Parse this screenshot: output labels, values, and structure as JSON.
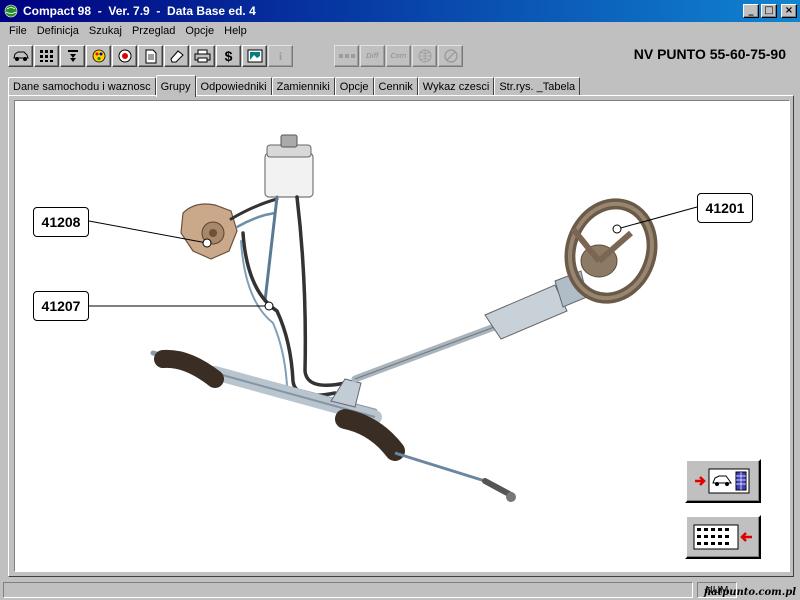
{
  "window": {
    "title": "Compact 98  -  Ver. 7.9  -  Data Base ed. 4",
    "minimize_glyph": "_",
    "maximize_glyph": "□",
    "close_glyph": "×"
  },
  "menu": {
    "items": [
      "File",
      "Definicja",
      "Szukaj",
      "Przeglad",
      "Opcje",
      "Help"
    ]
  },
  "toolbar": {
    "icons": [
      "car-icon",
      "grid-icon",
      "arrow-down-icon",
      "palette-icon",
      "target-icon",
      "document-icon",
      "eraser-icon",
      "printer-icon",
      "dollar-icon",
      "picture-icon",
      "info-icon"
    ],
    "dollar_glyph": "$",
    "info_glyph": "i",
    "disabled_labels": [
      "",
      "Diff",
      "Com"
    ]
  },
  "model": {
    "label": "NV PUNTO 55-60-75-90"
  },
  "tabs": [
    {
      "label": "Dane samochodu i waznosc",
      "active": false
    },
    {
      "label": "Grupy",
      "active": true
    },
    {
      "label": "Odpowiedniki",
      "active": false
    },
    {
      "label": "Zamienniki",
      "active": false
    },
    {
      "label": "Opcje",
      "active": false
    },
    {
      "label": "Cennik",
      "active": false
    },
    {
      "label": "Wykaz czesci",
      "active": false
    },
    {
      "label": "Str.rys. _Tabela",
      "active": false
    }
  ],
  "diagram": {
    "callouts": [
      "41208",
      "41207",
      "41201"
    ]
  },
  "status": {
    "num": "NUM"
  },
  "watermark": "fiatpunto.com.pl",
  "colors": {
    "title_start": "#000080",
    "title_end": "#1084d0",
    "face": "#c0c0c0",
    "arrow": "#e00000"
  }
}
